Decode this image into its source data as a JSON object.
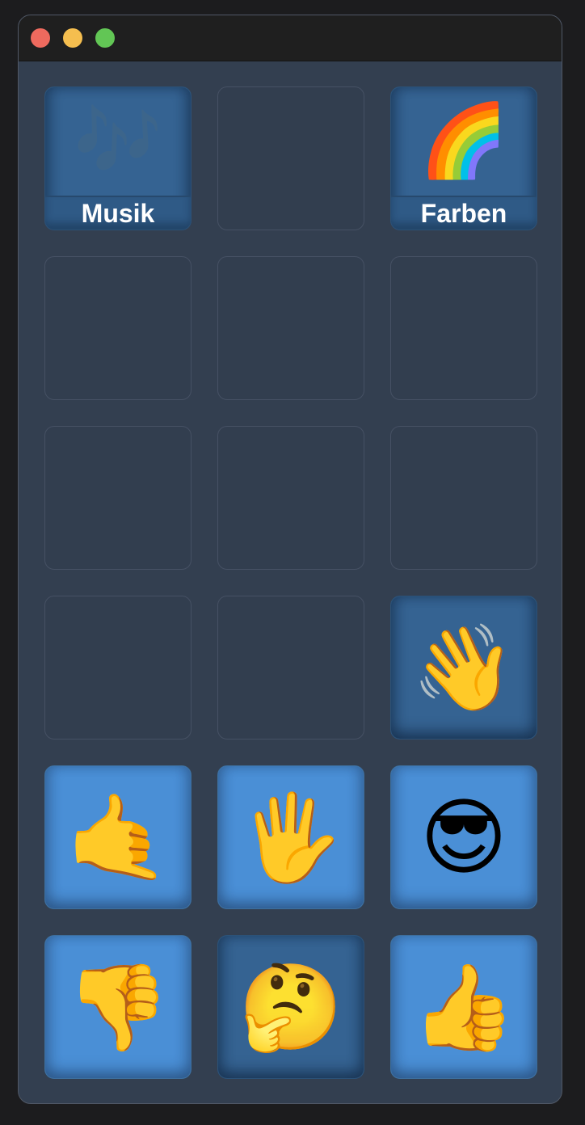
{
  "window": {
    "traffic_lights": [
      "close",
      "minimize",
      "maximize"
    ]
  },
  "keys": [
    {
      "emoji": "🎶",
      "label": "Musik",
      "icon": "musical-notes-icon",
      "style": "dark",
      "faded": true
    },
    {
      "emoji": "",
      "label": "",
      "style": "empty"
    },
    {
      "emoji": "🌈",
      "label": "Farben",
      "icon": "rainbow-icon",
      "style": "dark"
    },
    {
      "emoji": "",
      "label": "",
      "style": "empty"
    },
    {
      "emoji": "",
      "label": "",
      "style": "empty"
    },
    {
      "emoji": "",
      "label": "",
      "style": "empty"
    },
    {
      "emoji": "",
      "label": "",
      "style": "empty"
    },
    {
      "emoji": "",
      "label": "",
      "style": "empty"
    },
    {
      "emoji": "",
      "label": "",
      "style": "empty"
    },
    {
      "emoji": "",
      "label": "",
      "style": "empty"
    },
    {
      "emoji": "",
      "label": "",
      "style": "empty"
    },
    {
      "emoji": "👋",
      "label": "",
      "icon": "waving-hand-icon",
      "style": "dark"
    },
    {
      "emoji": "🤙",
      "label": "",
      "icon": "call-me-hand-icon",
      "style": "filled"
    },
    {
      "emoji": "🖐",
      "label": "",
      "icon": "raised-hand-icon",
      "style": "filled"
    },
    {
      "emoji": "😎",
      "label": "",
      "icon": "sunglasses-face-icon",
      "style": "filled"
    },
    {
      "emoji": "👎",
      "label": "",
      "icon": "thumbs-down-icon",
      "style": "filled"
    },
    {
      "emoji": "🤔",
      "label": "",
      "icon": "thinking-face-icon",
      "style": "dark"
    },
    {
      "emoji": "👍",
      "label": "",
      "icon": "thumbs-up-icon",
      "style": "filled"
    }
  ]
}
